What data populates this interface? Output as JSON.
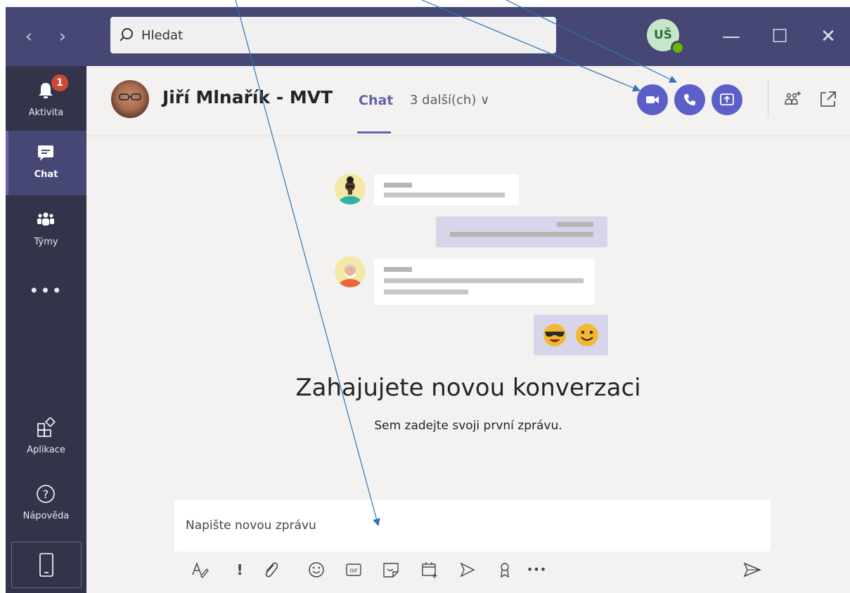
{
  "titlebar": {
    "back_icon": "chevron-left-icon",
    "forward_icon": "chevron-right-icon",
    "search_placeholder": "Hledat",
    "user_initials": "UŠ",
    "minimize_icon": "minimize-icon",
    "maximize_icon": "maximize-icon",
    "close_icon": "close-icon"
  },
  "rail": {
    "items": [
      {
        "label": "Aktivita",
        "icon": "bell-icon",
        "badge": "1"
      },
      {
        "label": "Chat",
        "icon": "chat-icon"
      },
      {
        "label": "Týmy",
        "icon": "teams-icon"
      },
      {
        "label": "Aplikace",
        "icon": "apps-icon"
      },
      {
        "label": "Nápověda",
        "icon": "help-icon"
      }
    ],
    "more": "•••"
  },
  "header": {
    "contact_name": "Jiří Mlnařík - MVT",
    "tab_chat": "Chat",
    "tab_more": "3 další(ch) ∨"
  },
  "empty_state": {
    "title": "Zahajujete novou konverzaci",
    "subtitle": "Sem zadejte svoji první zprávu."
  },
  "composer": {
    "placeholder": "Napište novou zprávu",
    "toolbar_more": "•••"
  },
  "colors": {
    "titlebar": "#464775",
    "rail": "#33344a",
    "accent": "#6264a7",
    "call_button": "#5b5fc7",
    "badge": "#cc4a31",
    "annotation_arrow": "#2e75b6"
  }
}
